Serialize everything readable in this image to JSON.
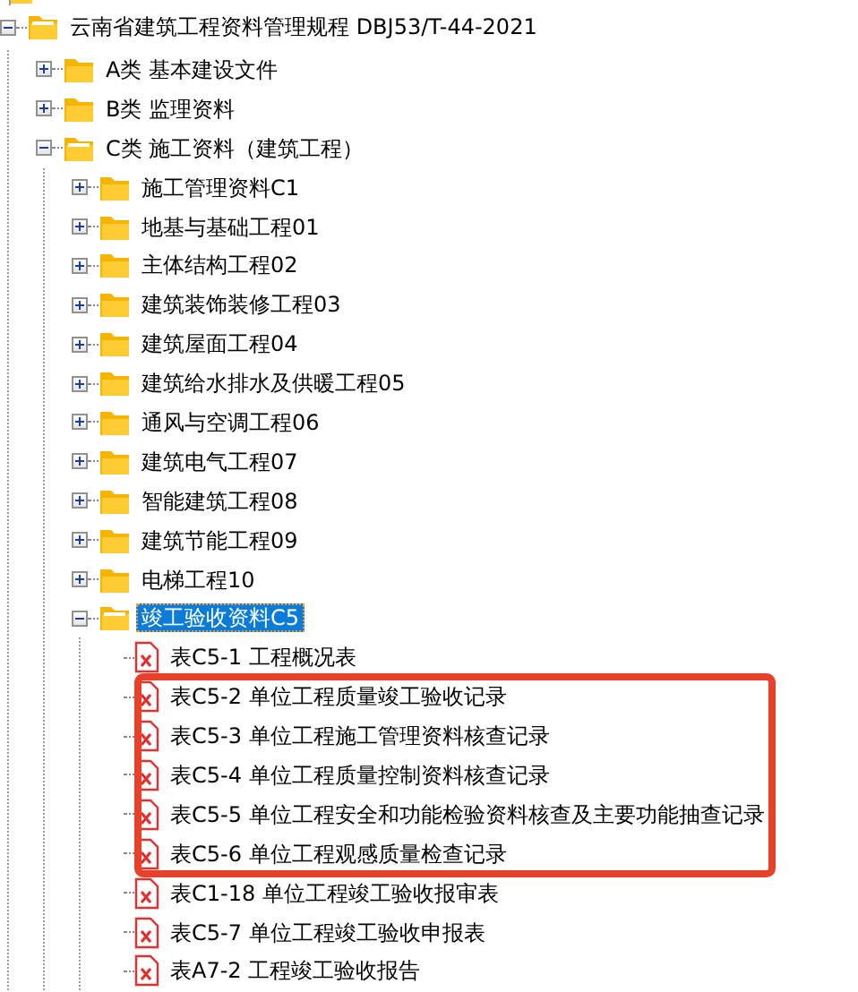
{
  "tree": [
    {
      "label": "云南省建筑工程资料管理规程 DBJ53/T-44-2021",
      "kind": "folder",
      "expanded": true,
      "selected": false,
      "children": [
        {
          "label": "A类 基本建设文件",
          "kind": "folder",
          "expanded": false,
          "selected": false
        },
        {
          "label": "B类 监理资料",
          "kind": "folder",
          "expanded": false,
          "selected": false
        },
        {
          "label": "C类 施工资料（建筑工程）",
          "kind": "folder",
          "expanded": true,
          "selected": false,
          "children": [
            {
              "label": "施工管理资料C1",
              "kind": "folder",
              "expanded": false,
              "selected": false
            },
            {
              "label": "地基与基础工程01",
              "kind": "folder",
              "expanded": false,
              "selected": false
            },
            {
              "label": "主体结构工程02",
              "kind": "folder",
              "expanded": false,
              "selected": false
            },
            {
              "label": "建筑装饰装修工程03",
              "kind": "folder",
              "expanded": false,
              "selected": false
            },
            {
              "label": "建筑屋面工程04",
              "kind": "folder",
              "expanded": false,
              "selected": false
            },
            {
              "label": "建筑给水排水及供暖工程05",
              "kind": "folder",
              "expanded": false,
              "selected": false
            },
            {
              "label": "通风与空调工程06",
              "kind": "folder",
              "expanded": false,
              "selected": false
            },
            {
              "label": "建筑电气工程07",
              "kind": "folder",
              "expanded": false,
              "selected": false
            },
            {
              "label": "智能建筑工程08",
              "kind": "folder",
              "expanded": false,
              "selected": false
            },
            {
              "label": "建筑节能工程09",
              "kind": "folder",
              "expanded": false,
              "selected": false
            },
            {
              "label": "电梯工程10",
              "kind": "folder",
              "expanded": false,
              "selected": false
            },
            {
              "label": "竣工验收资料C5",
              "kind": "folder",
              "expanded": true,
              "selected": true,
              "children": [
                {
                  "label": "表C5-1 工程概况表",
                  "kind": "file",
                  "selected": false,
                  "highlighted": false
                },
                {
                  "label": "表C5-2 单位工程质量竣工验收记录",
                  "kind": "file",
                  "selected": false,
                  "highlighted": true
                },
                {
                  "label": "表C5-3 单位工程施工管理资料核查记录",
                  "kind": "file",
                  "selected": false,
                  "highlighted": true
                },
                {
                  "label": "表C5-4 单位工程质量控制资料核查记录",
                  "kind": "file",
                  "selected": false,
                  "highlighted": true
                },
                {
                  "label": "表C5-5 单位工程安全和功能检验资料核查及主要功能抽查记录",
                  "kind": "file",
                  "selected": false,
                  "highlighted": true
                },
                {
                  "label": "表C5-6 单位工程观感质量检查记录",
                  "kind": "file",
                  "selected": false,
                  "highlighted": true
                },
                {
                  "label": "表C1-18 单位工程竣工验收报审表",
                  "kind": "file",
                  "selected": false,
                  "highlighted": false
                },
                {
                  "label": "表C5-7 单位工程竣工验收申报表",
                  "kind": "file",
                  "selected": false,
                  "highlighted": false
                },
                {
                  "label": "表A7-2 工程竣工验收报告",
                  "kind": "file",
                  "selected": false,
                  "highlighted": false
                }
              ]
            }
          ]
        }
      ]
    }
  ]
}
